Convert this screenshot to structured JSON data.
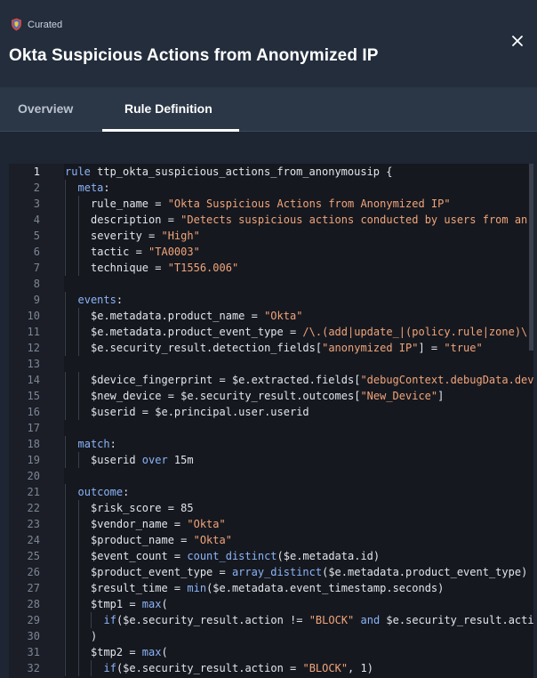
{
  "header": {
    "badge": "Curated",
    "title": "Okta Suspicious Actions from Anonymized IP"
  },
  "tabs": [
    {
      "label": "Overview",
      "active": false
    },
    {
      "label": "Rule Definition",
      "active": true
    }
  ],
  "code_lines": [
    {
      "n": "1",
      "indent": 0,
      "parts": [
        [
          "kw",
          "rule"
        ],
        [
          "p",
          " ttp_okta_suspicious_actions_from_anonymousip {"
        ]
      ]
    },
    {
      "n": "2",
      "indent": 1,
      "parts": [
        [
          "kw",
          "meta"
        ],
        [
          "p",
          ":"
        ]
      ]
    },
    {
      "n": "3",
      "indent": 2,
      "parts": [
        [
          "p",
          "rule_name = "
        ],
        [
          "str",
          "\"Okta Suspicious Actions from Anonymized IP\""
        ]
      ]
    },
    {
      "n": "4",
      "indent": 2,
      "parts": [
        [
          "p",
          "description = "
        ],
        [
          "str",
          "\"Detects suspicious actions conducted by users from an"
        ]
      ]
    },
    {
      "n": "5",
      "indent": 2,
      "parts": [
        [
          "p",
          "severity = "
        ],
        [
          "str",
          "\"High\""
        ]
      ]
    },
    {
      "n": "6",
      "indent": 2,
      "parts": [
        [
          "p",
          "tactic = "
        ],
        [
          "str",
          "\"TA0003\""
        ]
      ]
    },
    {
      "n": "7",
      "indent": 2,
      "parts": [
        [
          "p",
          "technique = "
        ],
        [
          "str",
          "\"T1556.006\""
        ]
      ]
    },
    {
      "n": "8",
      "indent": 0,
      "parts": []
    },
    {
      "n": "9",
      "indent": 1,
      "parts": [
        [
          "kw",
          "events"
        ],
        [
          "p",
          ":"
        ]
      ]
    },
    {
      "n": "10",
      "indent": 2,
      "parts": [
        [
          "p",
          "$e.metadata.product_name = "
        ],
        [
          "str",
          "\"Okta\""
        ]
      ]
    },
    {
      "n": "11",
      "indent": 2,
      "parts": [
        [
          "p",
          "$e.metadata.product_event_type = "
        ],
        [
          "re",
          "/\\.(add|update_|(policy.rule|zone)\\."
        ]
      ]
    },
    {
      "n": "12",
      "indent": 2,
      "parts": [
        [
          "p",
          "$e.security_result.detection_fields["
        ],
        [
          "str",
          "\"anonymized IP\""
        ],
        [
          "p",
          "] = "
        ],
        [
          "str",
          "\"true\""
        ]
      ]
    },
    {
      "n": "13",
      "indent": 0,
      "parts": []
    },
    {
      "n": "14",
      "indent": 2,
      "parts": [
        [
          "p",
          "$device_fingerprint = $e.extracted.fields["
        ],
        [
          "str",
          "\"debugContext.debugData.dev"
        ]
      ]
    },
    {
      "n": "15",
      "indent": 2,
      "parts": [
        [
          "p",
          "$new_device = $e.security_result.outcomes["
        ],
        [
          "str",
          "\"New_Device\""
        ],
        [
          "p",
          "]"
        ]
      ]
    },
    {
      "n": "16",
      "indent": 2,
      "parts": [
        [
          "p",
          "$userid = $e.principal.user.userid"
        ]
      ]
    },
    {
      "n": "17",
      "indent": 0,
      "parts": []
    },
    {
      "n": "18",
      "indent": 1,
      "parts": [
        [
          "kw",
          "match"
        ],
        [
          "p",
          ":"
        ]
      ]
    },
    {
      "n": "19",
      "indent": 2,
      "parts": [
        [
          "p",
          "$userid "
        ],
        [
          "kw",
          "over"
        ],
        [
          "p",
          " 15m"
        ]
      ]
    },
    {
      "n": "20",
      "indent": 0,
      "parts": []
    },
    {
      "n": "21",
      "indent": 1,
      "parts": [
        [
          "kw",
          "outcome"
        ],
        [
          "p",
          ":"
        ]
      ]
    },
    {
      "n": "22",
      "indent": 2,
      "parts": [
        [
          "p",
          "$risk_score = 85"
        ]
      ]
    },
    {
      "n": "23",
      "indent": 2,
      "parts": [
        [
          "p",
          "$vendor_name = "
        ],
        [
          "str",
          "\"Okta\""
        ]
      ]
    },
    {
      "n": "24",
      "indent": 2,
      "parts": [
        [
          "p",
          "$product_name = "
        ],
        [
          "str",
          "\"Okta\""
        ]
      ]
    },
    {
      "n": "25",
      "indent": 2,
      "parts": [
        [
          "p",
          "$event_count = "
        ],
        [
          "kw",
          "count_distinct"
        ],
        [
          "p",
          "($e.metadata.id)"
        ]
      ]
    },
    {
      "n": "26",
      "indent": 2,
      "parts": [
        [
          "p",
          "$product_event_type = "
        ],
        [
          "kw",
          "array_distinct"
        ],
        [
          "p",
          "($e.metadata.product_event_type)"
        ]
      ]
    },
    {
      "n": "27",
      "indent": 2,
      "parts": [
        [
          "p",
          "$result_time = "
        ],
        [
          "kw",
          "min"
        ],
        [
          "p",
          "($e.metadata.event_timestamp.seconds)"
        ]
      ]
    },
    {
      "n": "28",
      "indent": 2,
      "parts": [
        [
          "p",
          "$tmp1 = "
        ],
        [
          "kw",
          "max"
        ],
        [
          "p",
          "("
        ]
      ]
    },
    {
      "n": "29",
      "indent": 3,
      "parts": [
        [
          "kw",
          "if"
        ],
        [
          "p",
          "($e.security_result.action != "
        ],
        [
          "str",
          "\"BLOCK\""
        ],
        [
          "p",
          " "
        ],
        [
          "kw",
          "and"
        ],
        [
          "p",
          " $e.security_result.acti"
        ]
      ]
    },
    {
      "n": "30",
      "indent": 2,
      "parts": [
        [
          "p",
          ")"
        ]
      ]
    },
    {
      "n": "31",
      "indent": 2,
      "parts": [
        [
          "p",
          "$tmp2 = "
        ],
        [
          "kw",
          "max"
        ],
        [
          "p",
          "("
        ]
      ]
    },
    {
      "n": "32",
      "indent": 3,
      "parts": [
        [
          "kw",
          "if"
        ],
        [
          "p",
          "($e.security_result.action = "
        ],
        [
          "str",
          "\"BLOCK\""
        ],
        [
          "p",
          ", 1)"
        ]
      ]
    }
  ]
}
